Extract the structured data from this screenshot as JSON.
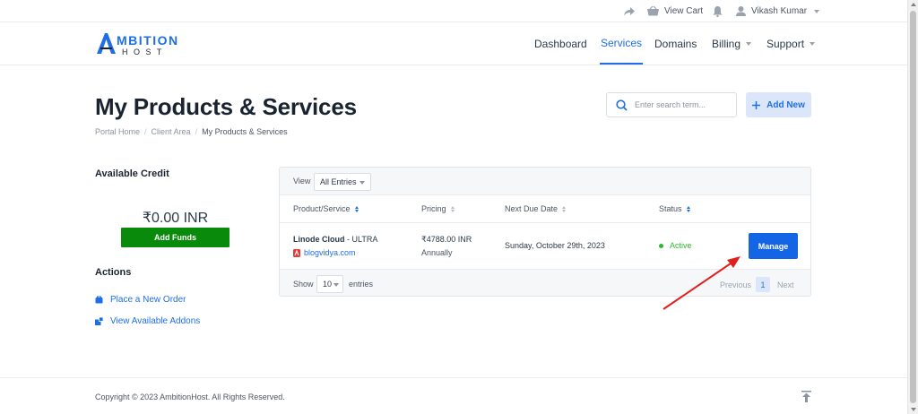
{
  "topbar": {
    "view_cart": "View Cart",
    "user_name": "Vikash Kumar"
  },
  "brand": {
    "logo_line1": "MBITION",
    "logo_line2": "H O S T",
    "accent_color": "#1e6fe6"
  },
  "nav": {
    "items": [
      {
        "label": "Dashboard",
        "active": false,
        "dropdown": false
      },
      {
        "label": "Services",
        "active": true,
        "dropdown": false
      },
      {
        "label": "Domains",
        "active": false,
        "dropdown": false
      },
      {
        "label": "Billing",
        "active": false,
        "dropdown": true
      },
      {
        "label": "Support",
        "active": false,
        "dropdown": true
      }
    ]
  },
  "page": {
    "title": "My Products & Services",
    "breadcrumb": [
      "Portal Home",
      "Client Area",
      "My Products & Services"
    ],
    "search_placeholder": "Enter search term...",
    "add_new_label": "Add New"
  },
  "sidebar": {
    "credit_heading": "Available Credit",
    "credit_amount": "₹0.00 INR",
    "add_funds_label": "Add Funds",
    "actions_heading": "Actions",
    "actions": [
      {
        "label": "Place a New Order",
        "icon": "cart-icon"
      },
      {
        "label": "View Available Addons",
        "icon": "addons-icon"
      }
    ]
  },
  "table": {
    "view_label": "View",
    "view_filter": "All Entries",
    "columns": [
      "Product/Service",
      "Pricing",
      "Next Due Date",
      "Status"
    ],
    "rows": [
      {
        "product_name": "Linode Cloud",
        "product_plan": "- ULTRA",
        "domain": "blogvidya.com",
        "price": "₹4788.00 INR",
        "cycle": "Annually",
        "next_due": "Sunday, October 29th, 2023",
        "status": "Active",
        "action_label": "Manage"
      }
    ],
    "show_label": "Show",
    "page_size": "10",
    "entries_label": "entries",
    "pagination": {
      "previous": "Previous",
      "current": "1",
      "next": "Next"
    }
  },
  "footer": {
    "copyright": "Copyright © 2023 AmbitionHost. All Rights Reserved."
  },
  "colors": {
    "primary": "#1465e6",
    "success": "#0a8a0a",
    "active_status": "#2eb82e",
    "annotation_arrow": "#e02020"
  }
}
